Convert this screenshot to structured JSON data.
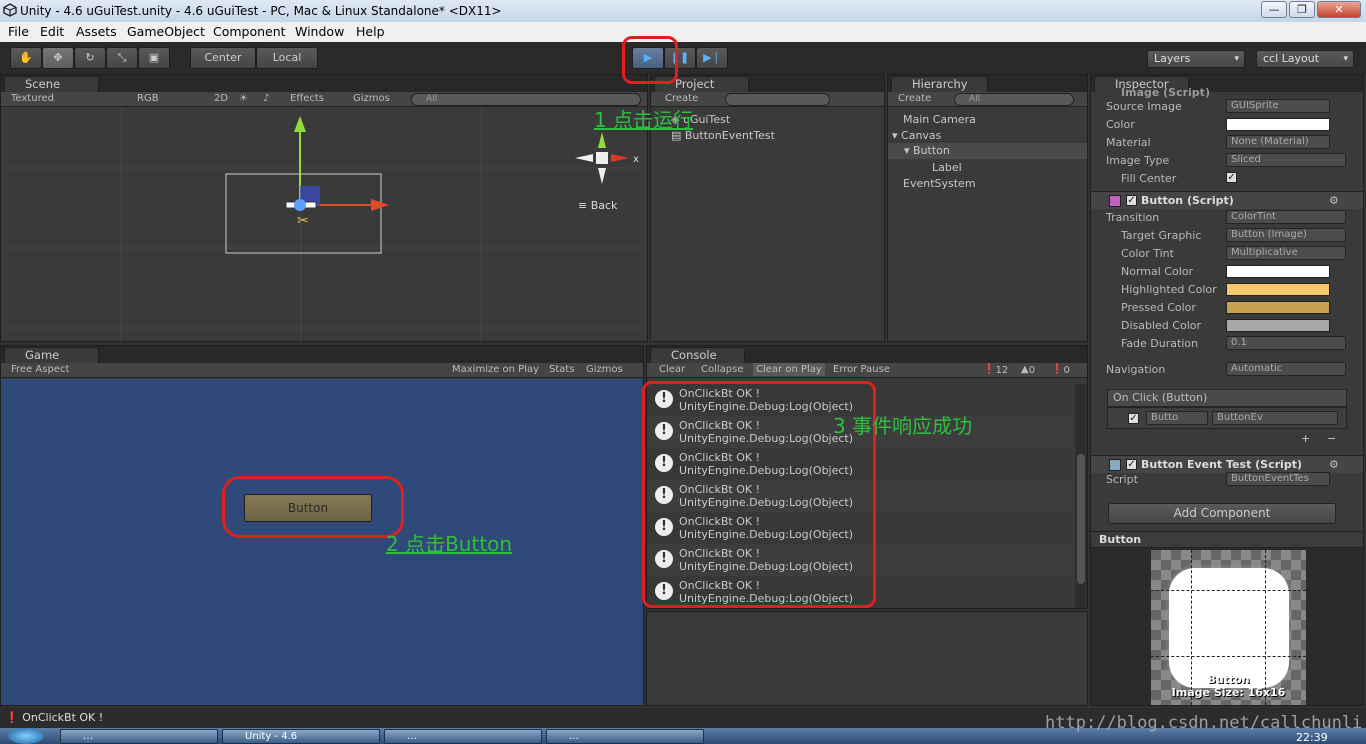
{
  "window": {
    "title": "Unity - 4.6 uGuiTest.unity - 4.6 uGuiTest - PC, Mac & Linux Standalone* <DX11>"
  },
  "menu": [
    "File",
    "Edit",
    "Assets",
    "GameObject",
    "Component",
    "Window",
    "Help"
  ],
  "toolbar": {
    "pivot_center": "Center",
    "pivot_local": "Local",
    "layers": "Layers",
    "layout": "ccl Layout"
  },
  "scene": {
    "tab": "Scene",
    "shading": "Textured",
    "color": "RGB",
    "mode2d": "2D",
    "effects": "Effects",
    "gizmos": "Gizmos",
    "search_placeholder": "All",
    "back_label": "Back"
  },
  "project": {
    "tab": "Project",
    "create": "Create",
    "items": [
      "uGuiTest",
      "ButtonEventTest"
    ]
  },
  "hierarchy": {
    "tab": "Hierarchy",
    "create": "Create",
    "search_placeholder": "All",
    "items": [
      "Main Camera",
      "Canvas",
      "Button",
      "Label",
      "EventSystem"
    ]
  },
  "inspector": {
    "tab": "Inspector",
    "image_header": "Image (Script)",
    "source_image": {
      "label": "Source Image",
      "value": "GUISprite"
    },
    "color_label": "Color",
    "material": {
      "label": "Material",
      "value": "None (Material)"
    },
    "image_type": {
      "label": "Image Type",
      "value": "Sliced"
    },
    "fill_center": "Fill Center",
    "button_header": "Button (Script)",
    "transition": {
      "label": "Transition",
      "value": "ColorTint"
    },
    "target_graphic": {
      "label": "Target Graphic",
      "value": "Button (Image)"
    },
    "color_tint": {
      "label": "Color Tint",
      "value": "Multiplicative"
    },
    "normal_color": "Normal Color",
    "highlighted_color": "Highlighted Color",
    "pressed_color": "Pressed Color",
    "disabled_color": "Disabled Color",
    "fade_duration": {
      "label": "Fade Duration",
      "value": "0.1"
    },
    "navigation": {
      "label": "Navigation",
      "value": "Automatic"
    },
    "onclick_header": "On Click (Button)",
    "onclick_target": "Butto",
    "onclick_func": "ButtonEv",
    "event_header": "Button Event Test (Script)",
    "script": {
      "label": "Script",
      "value": "ButtonEventTes"
    },
    "add_component": "Add Component",
    "preview_title": "Button",
    "preview_name": "Button",
    "preview_size": "Image Size: 16x16",
    "colors": {
      "normal": "#ffffff",
      "highlighted": "#f5c96a",
      "pressed": "#c8a24f",
      "disabled": "#a8a8a8"
    }
  },
  "game": {
    "tab": "Game",
    "aspect": "Free Aspect",
    "maximize": "Maximize on Play",
    "stats": "Stats",
    "gizmos": "Gizmos",
    "button_label": "Button",
    "bg": "#2f4a78"
  },
  "console": {
    "tab": "Console",
    "clear": "Clear",
    "collapse": "Collapse",
    "clear_on_play": "Clear on Play",
    "error_pause": "Error Pause",
    "count_log": "12",
    "count_warn": "0",
    "count_err": "0",
    "entries": [
      {
        "line1": "OnClickBt OK !",
        "line2": "UnityEngine.Debug:Log(Object)"
      },
      {
        "line1": "OnClickBt OK !",
        "line2": "UnityEngine.Debug:Log(Object)"
      },
      {
        "line1": "OnClickBt OK !",
        "line2": "UnityEngine.Debug:Log(Object)"
      },
      {
        "line1": "OnClickBt OK !",
        "line2": "UnityEngine.Debug:Log(Object)"
      },
      {
        "line1": "OnClickBt OK !",
        "line2": "UnityEngine.Debug:Log(Object)"
      },
      {
        "line1": "OnClickBt OK !",
        "line2": "UnityEngine.Debug:Log(Object)"
      },
      {
        "line1": "OnClickBt OK !",
        "line2": "UnityEngine.Debug:Log(Object)"
      }
    ]
  },
  "status": {
    "message": "OnClickBt OK !"
  },
  "annotations": {
    "step1": "1 点击运行",
    "step2": "2 点击Button",
    "step3": "3 事件响应成功"
  },
  "watermark": "http://blog.csdn.net/callchunli",
  "taskbar": {
    "clock": "22:39",
    "tasks": [
      "…",
      "Unity - 4.6",
      "…",
      "…"
    ]
  }
}
